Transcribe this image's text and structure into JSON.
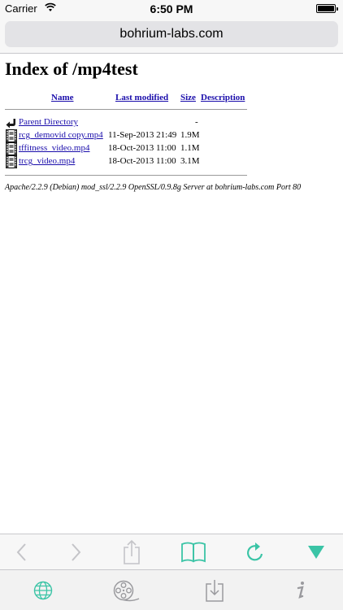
{
  "status_bar": {
    "carrier": "Carrier",
    "time": "6:50 PM",
    "battery_level": 1.0
  },
  "browser": {
    "url": "bohrium-labs.com"
  },
  "page": {
    "title": "Index of /mp4test",
    "columns": {
      "name": "Name",
      "last_modified": "Last modified",
      "size": "Size",
      "description": "Description"
    },
    "parent": {
      "name": "Parent Directory",
      "size": "-",
      "icon": "back-arrow-icon"
    },
    "files": [
      {
        "name": "rcg_demovid copy.mp4",
        "modified": "11-Sep-2013 21:49",
        "size": "1.9M",
        "icon": "movie-file-icon"
      },
      {
        "name": "tffitness_video.mp4",
        "modified": "18-Oct-2013 11:00",
        "size": "1.1M",
        "icon": "movie-file-icon"
      },
      {
        "name": "trcg_video.mp4",
        "modified": "18-Oct-2013 11:00",
        "size": "3.1M",
        "icon": "movie-file-icon"
      }
    ],
    "server_signature": "Apache/2.2.9 (Debian) mod_ssl/2.2.9 OpenSSL/0.9.8g Server at bohrium-labs.com Port 80"
  },
  "nav_toolbar": {
    "buttons": [
      "back-icon",
      "forward-icon",
      "share-icon",
      "bookmarks-icon",
      "reload-icon",
      "menu-down-icon"
    ],
    "accent_color": "#3bc4a6",
    "disabled_color": "#c4c4c8"
  },
  "tab_toolbar": {
    "buttons": [
      "browser-globe-icon",
      "videos-icon",
      "downloads-icon",
      "info-icon"
    ],
    "active_color": "#3bc4a6",
    "inactive_color": "#9a9a9e"
  }
}
